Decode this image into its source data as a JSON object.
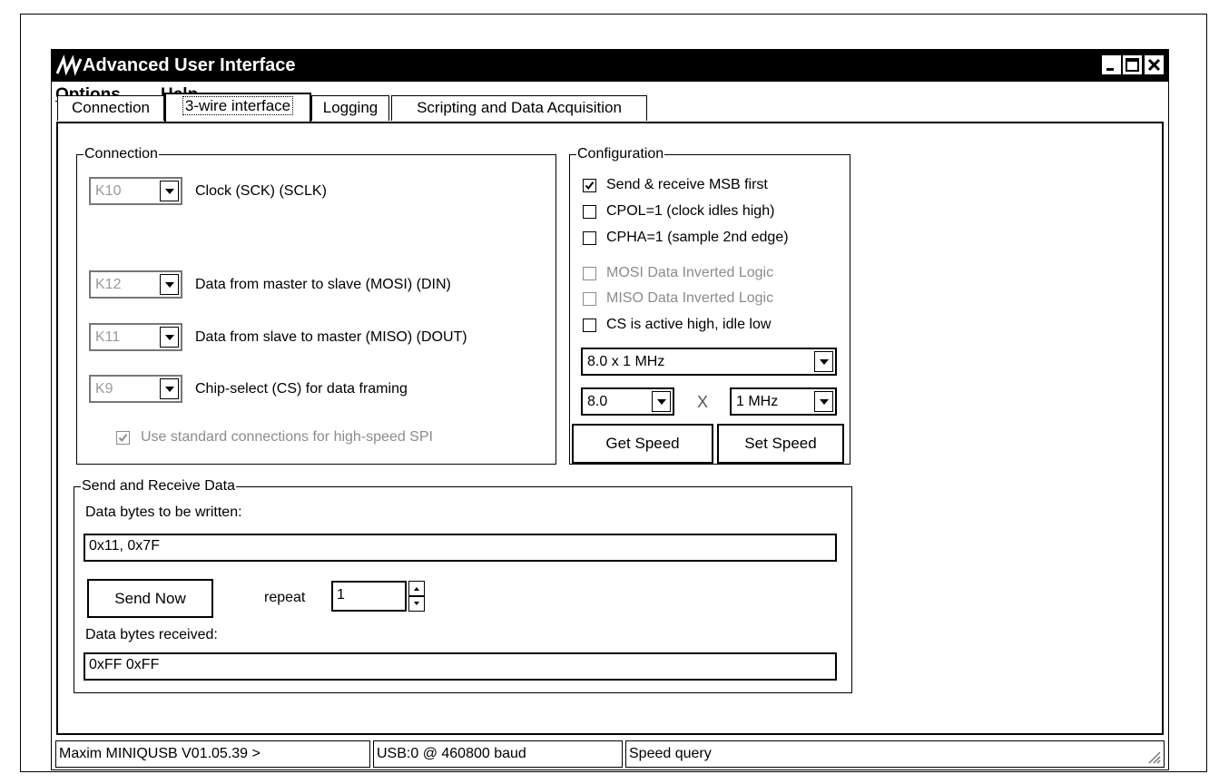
{
  "window": {
    "title": "Advanced User Interface",
    "logo_icon": "maxim-logo-icon"
  },
  "menu": {
    "options": {
      "first": "O",
      "rest": "ptions"
    },
    "help": {
      "first": "H",
      "rest": "elp"
    }
  },
  "tabs": [
    {
      "label": "Connection"
    },
    {
      "label": "3-wire interface"
    },
    {
      "label": "Logging"
    },
    {
      "label": "Scripting and Data Acquisition"
    }
  ],
  "connection": {
    "title": "Connection",
    "clock": {
      "pin": "K10",
      "label": "Clock (SCK) (SCLK)"
    },
    "mosi": {
      "pin": "K12",
      "label": "Data from master to slave (MOSI) (DIN)"
    },
    "miso": {
      "pin": "K11",
      "label": "Data from slave to master (MISO) (DOUT)"
    },
    "cs": {
      "pin": "K9",
      "label": "Chip-select (CS) for data framing"
    },
    "standard": {
      "label": "Use standard connections for high-speed SPI",
      "checked": true
    }
  },
  "configuration": {
    "title": "Configuration",
    "msb_first": {
      "label": "Send & receive MSB first",
      "checked": true
    },
    "cpol": {
      "label": "CPOL=1 (clock idles high)",
      "checked": false
    },
    "cpha": {
      "label": "CPHA=1 (sample 2nd edge)",
      "checked": false
    },
    "mosi_inverted": {
      "label": "MOSI Data Inverted Logic",
      "checked": false
    },
    "miso_inverted": {
      "label": "MISO Data Inverted Logic",
      "checked": false
    },
    "cs_active_high": {
      "label": "CS is active high, idle low",
      "checked": false
    },
    "speed": "8.0 x 1 MHz",
    "multiplier": "8.0",
    "times": "X",
    "unit": "1 MHz",
    "get_speed": "Get Speed",
    "set_speed": "Set Speed"
  },
  "send_receive": {
    "title": "Send and Receive Data",
    "write_label": "Data bytes to be written:",
    "write_value": "0x11, 0x7F",
    "send_now": "Send Now",
    "repeat_label": "repeat",
    "repeat_value": "1",
    "received_label": "Data bytes received:",
    "received_value": "0xFF 0xFF"
  },
  "status": {
    "device": "Maxim MINIQUSB V01.05.39 >",
    "port": "USB:0 @ 460800 baud",
    "message": "Speed query"
  }
}
